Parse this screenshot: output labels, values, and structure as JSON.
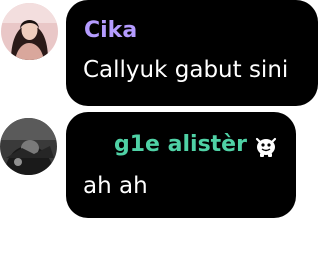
{
  "colors": {
    "bubble_bg": "#000000",
    "message_text": "#ffffff",
    "name_1": "#b59cff",
    "name_2": "#4fd1a5"
  },
  "messages": [
    {
      "author": "Cika",
      "text": "Callyuk gabut sini",
      "avatar_icon": "profile-photo"
    },
    {
      "author": "g1e alistèr",
      "text": "ah ah",
      "avatar_icon": "profile-photo",
      "badge_icon": "mascot-badge-icon"
    }
  ]
}
